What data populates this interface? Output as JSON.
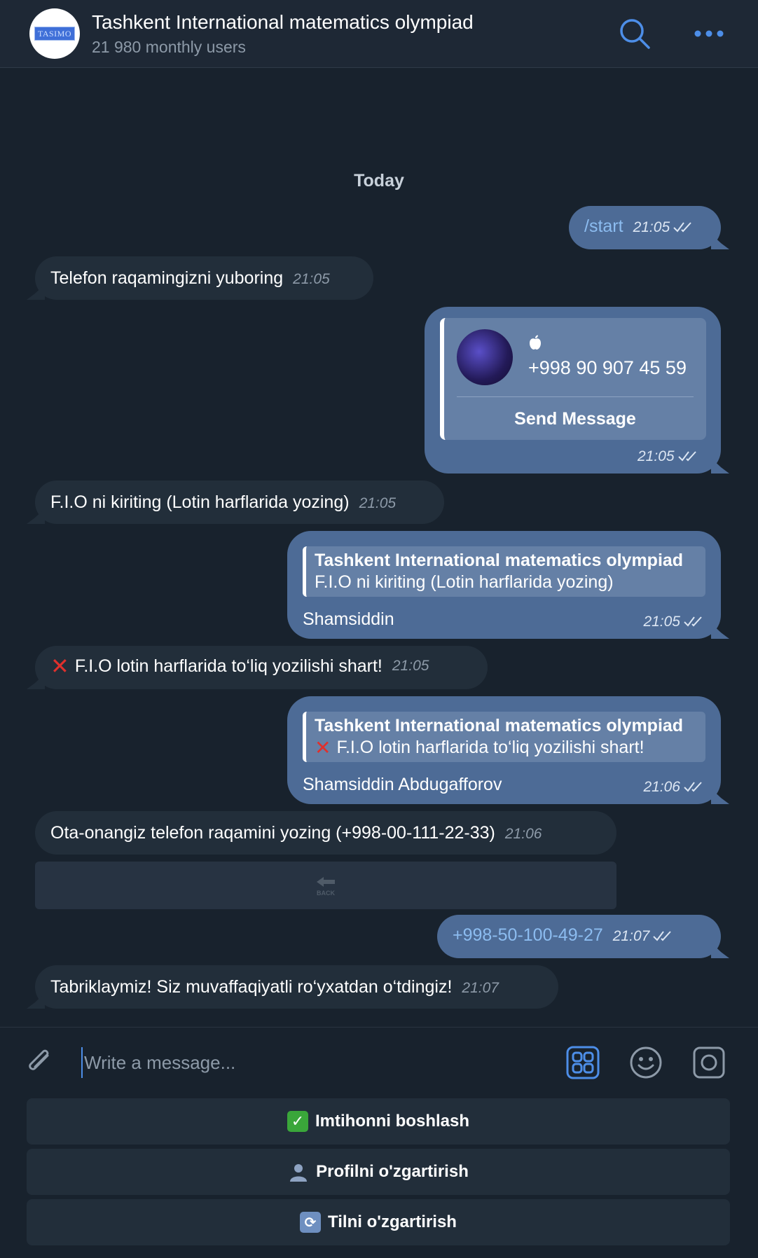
{
  "header": {
    "avatar_text": "TASIMO",
    "title": "Tashkent International matematics olympiad",
    "subtitle": "21 980 monthly users"
  },
  "chat": {
    "date_separator": "Today",
    "messages": [
      {
        "dir": "out",
        "text": "/start",
        "time": "21:05"
      },
      {
        "dir": "in",
        "text": "Telefon raqamingizni yuboring",
        "time": "21:05"
      },
      {
        "dir": "out",
        "type": "contact",
        "phone": "+998 90 907 45 59",
        "action": "Send Message",
        "time": "21:05"
      },
      {
        "dir": "in",
        "text": "F.I.O ni kiriting (Lotin harflarida yozing)",
        "time": "21:05"
      },
      {
        "dir": "out",
        "reply_name": "Tashkent International matematics olympiad",
        "reply_text": "F.I.O ni kiriting (Lotin harflarida yozing)",
        "text": "Shamsiddin",
        "time": "21:05"
      },
      {
        "dir": "in",
        "text": "F.I.O lotin harflarida to‘liq yozilishi shart!",
        "time": "21:05"
      },
      {
        "dir": "out",
        "reply_name": "Tashkent International matematics olympiad",
        "reply_text": "F.I.O lotin harflarida to‘liq yozilishi shart!",
        "text": "Shamsiddin Abdugafforov",
        "time": "21:06"
      },
      {
        "dir": "in",
        "text": "Ota-onangiz telefon raqamini yozing (+998-00-111-22-33)",
        "time": "21:06",
        "inline_button": "BACK"
      },
      {
        "dir": "out",
        "text": "+998-50-100-49-27",
        "time": "21:07"
      },
      {
        "dir": "in",
        "text": "Tabriklaymiz! Siz muvaffaqiyatli ro‘yxatdan o‘tdingiz!",
        "time": "21:07"
      }
    ]
  },
  "composer": {
    "placeholder": "Write a message..."
  },
  "keyboard": [
    {
      "icon": "check-icon",
      "label": "Imtihonni boshlash"
    },
    {
      "icon": "user-icon",
      "label": "Profilni o'zgartirish"
    },
    {
      "icon": "refresh-icon",
      "label": "Tilni o'zgartirish"
    }
  ],
  "colors": {
    "background": "#18222d",
    "incoming_bubble": "#222e3a",
    "outgoing_bubble": "#4d6b96",
    "accent": "#4d8ee8"
  }
}
